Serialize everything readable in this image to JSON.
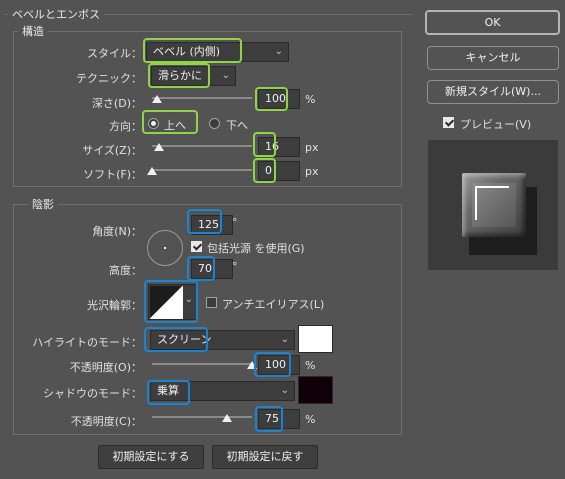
{
  "dialog": {
    "group_title": "ベベルとエンボス",
    "structure_title": "構造",
    "shading_title": "陰影"
  },
  "structure": {
    "style_label": "スタイル：",
    "style_value": "ベベル (内側)",
    "technique_label": "テクニック：",
    "technique_value": "滑らかに",
    "depth_label": "深さ(D)：",
    "depth_value": "100",
    "depth_unit": "%",
    "depth_level": 0.05,
    "direction_label": "方向：",
    "direction_up": "上へ",
    "direction_down": "下へ",
    "direction_selected": "up",
    "size_label": "サイズ(Z)：",
    "size_value": "16",
    "size_unit": "px",
    "size_level": 0.07,
    "soften_label": "ソフト(F)：",
    "soften_value": "0",
    "soften_unit": "px",
    "soften_level": 0.0
  },
  "shading": {
    "angle_label": "角度(N)：",
    "angle_value": "125",
    "angle_unit": "°",
    "global_light_label": "包括光源 を使用(G)",
    "global_light_checked": true,
    "altitude_label": "高度：",
    "altitude_value": "70",
    "altitude_unit": "°",
    "gloss_contour_label": "光沢輪郭：",
    "anti_alias_label": "アンチエイリアス(L)",
    "anti_alias_checked": false,
    "highlight_mode_label": "ハイライトのモード：",
    "highlight_mode_value": "スクリーン",
    "highlight_color": "#ffffff",
    "highlight_opacity_label": "不透明度(O)：",
    "highlight_opacity_value": "100",
    "highlight_opacity_unit": "%",
    "shadow_mode_label": "シャドウのモード：",
    "shadow_mode_value": "乗算",
    "shadow_color": "#120008",
    "shadow_opacity_label": "不透明度(C)：",
    "shadow_opacity_value": "75",
    "shadow_opacity_unit": "%"
  },
  "footer": {
    "make_default": "初期設定にする",
    "reset_default": "初期設定に戻す"
  },
  "side": {
    "ok": "OK",
    "cancel": "キャンセル",
    "new_style": "新規スタイル(W)...",
    "preview_label": "プレビュー(V)",
    "preview_checked": true
  },
  "colors": {
    "panel_bg": "#535353",
    "highlight_green": "#8fd444",
    "highlight_blue": "#1a83d4"
  }
}
